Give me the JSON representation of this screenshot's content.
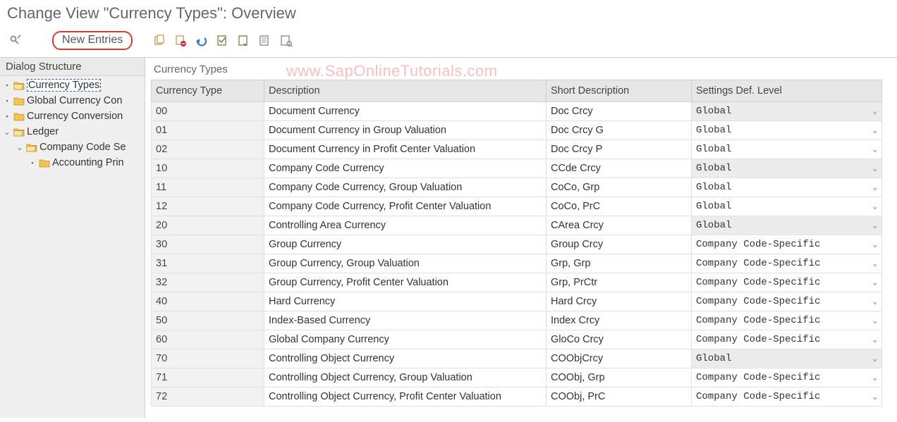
{
  "page_title": "Change View \"Currency Types\": Overview",
  "toolbar": {
    "new_entries_label": "New Entries"
  },
  "tree": {
    "header": "Dialog Structure",
    "nodes": [
      {
        "label": "Currency Types",
        "selected": true
      },
      {
        "label": "Global Currency Con"
      },
      {
        "label": "Currency Conversion"
      },
      {
        "label": "Ledger",
        "expanded": true
      },
      {
        "label": "Company Code Se",
        "expanded": true,
        "indent": 1
      },
      {
        "label": "Accounting Prin",
        "indent": 2
      }
    ]
  },
  "watermark": "www.SapOnlineTutorials.com",
  "grid": {
    "title": "Currency Types",
    "columns": {
      "currency_type": "Currency Type",
      "description": "Description",
      "short_description": "Short Description",
      "settings_level": "Settings Def. Level"
    },
    "rows": [
      {
        "ct": "00",
        "desc": "Document Currency",
        "short": "Doc Crcy",
        "level": "Global",
        "grey": true
      },
      {
        "ct": "01",
        "desc": "Document Currency in Group Valuation",
        "short": "Doc Crcy G",
        "level": "Global",
        "grey": false
      },
      {
        "ct": "02",
        "desc": "Document Currency in Profit Center Valuation",
        "short": "Doc Crcy P",
        "level": "Global",
        "grey": false
      },
      {
        "ct": "10",
        "desc": "Company Code Currency",
        "short": "CCde Crcy",
        "level": "Global",
        "grey": true
      },
      {
        "ct": "11",
        "desc": "Company Code Currency, Group Valuation",
        "short": "CoCo, Grp",
        "level": "Global",
        "grey": false
      },
      {
        "ct": "12",
        "desc": "Company Code Currency, Profit Center Valuation",
        "short": "CoCo, PrC",
        "level": "Global",
        "grey": false
      },
      {
        "ct": "20",
        "desc": "Controlling Area Currency",
        "short": "CArea Crcy",
        "level": "Global",
        "grey": true
      },
      {
        "ct": "30",
        "desc": "Group Currency",
        "short": "Group Crcy",
        "level": "Company Code-Specific",
        "grey": false
      },
      {
        "ct": "31",
        "desc": "Group Currency, Group Valuation",
        "short": "Grp, Grp",
        "level": "Company Code-Specific",
        "grey": false
      },
      {
        "ct": "32",
        "desc": "Group Currency, Profit Center Valuation",
        "short": "Grp, PrCtr",
        "level": "Company Code-Specific",
        "grey": false
      },
      {
        "ct": "40",
        "desc": "Hard Currency",
        "short": "Hard Crcy",
        "level": "Company Code-Specific",
        "grey": false
      },
      {
        "ct": "50",
        "desc": "Index-Based Currency",
        "short": "Index Crcy",
        "level": "Company Code-Specific",
        "grey": false
      },
      {
        "ct": "60",
        "desc": "Global Company Currency",
        "short": "GloCo Crcy",
        "level": "Company Code-Specific",
        "grey": false
      },
      {
        "ct": "70",
        "desc": "Controlling Object Currency",
        "short": "COObjCrcy",
        "level": "Global",
        "grey": true
      },
      {
        "ct": "71",
        "desc": "Controlling Object Currency, Group Valuation",
        "short": "COObj, Grp",
        "level": "Company Code-Specific",
        "grey": false
      },
      {
        "ct": "72",
        "desc": "Controlling Object Currency, Profit Center Valuation",
        "short": "COObj, PrC",
        "level": "Company Code-Specific",
        "grey": false
      }
    ]
  }
}
